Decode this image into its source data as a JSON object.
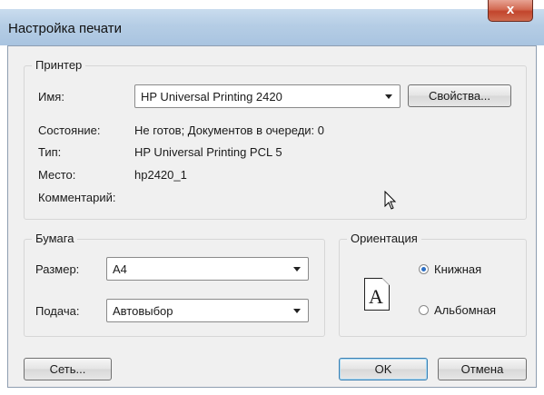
{
  "window": {
    "title": "Настройка печати",
    "close_glyph": "x"
  },
  "printer": {
    "group_label": "Принтер",
    "name_label": "Имя:",
    "name_value": "HP Universal Printing 2420",
    "properties_button": "Свойства...",
    "status_label": "Состояние:",
    "status_value": "Не готов; Документов в очереди: 0",
    "type_label": "Тип:",
    "type_value": "HP Universal Printing PCL 5",
    "location_label": "Место:",
    "location_value": "hp2420_1",
    "comment_label": "Комментарий:",
    "comment_value": ""
  },
  "paper": {
    "group_label": "Бумага",
    "size_label": "Размер:",
    "size_value": "A4",
    "source_label": "Подача:",
    "source_value": "Автовыбор"
  },
  "orientation": {
    "group_label": "Ориентация",
    "icon_letter": "A",
    "portrait_label": "Книжная",
    "landscape_label": "Альбомная",
    "selected": "portrait"
  },
  "buttons": {
    "network": "Сеть...",
    "ok": "OK",
    "cancel": "Отмена"
  },
  "colors": {
    "title_bar": "#b5cde5",
    "close_button": "#c2452c",
    "radio_selected": "#2d6fc4"
  }
}
